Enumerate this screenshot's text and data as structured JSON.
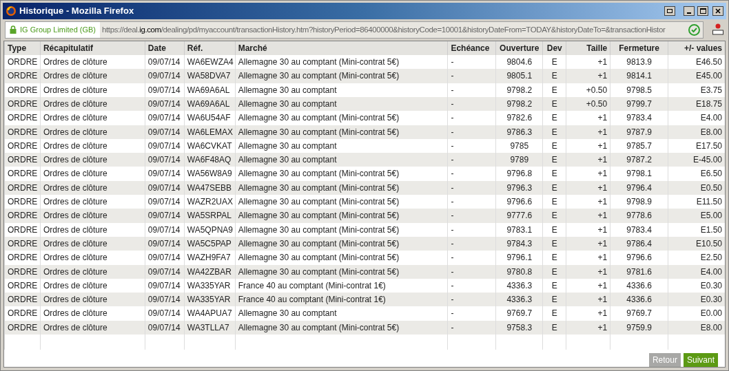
{
  "window": {
    "title": "Historique - Mozilla Firefox"
  },
  "address_bar": {
    "identity": "IG Group Limited (GB)",
    "url_prefix": "https://deal.",
    "url_domain": "ig.com",
    "url_rest": "/dealing/pd/myaccount/transactionHistory.htm?historyPeriod=86400000&historyCode=10001&historyDateFrom=TODAY&historyDateTo=&transactionHistor"
  },
  "table": {
    "columns": [
      "Type",
      "Récapitulatif",
      "Date",
      "Réf.",
      "Marché",
      "Echéance",
      "Ouverture",
      "Dev",
      "Taille",
      "Fermeture",
      "+/- values"
    ],
    "rows": [
      [
        "ORDRE",
        "Ordres de clôture",
        "09/07/14",
        "WA6EWZA4",
        "Allemagne 30 au comptant (Mini-contrat 5€)",
        "-",
        "9804.6",
        "E",
        "+1",
        "9813.9",
        "E46.50"
      ],
      [
        "ORDRE",
        "Ordres de clôture",
        "09/07/14",
        "WA58DVA7",
        "Allemagne 30 au comptant (Mini-contrat 5€)",
        "-",
        "9805.1",
        "E",
        "+1",
        "9814.1",
        "E45.00"
      ],
      [
        "ORDRE",
        "Ordres de clôture",
        "09/07/14",
        "WA69A6AL",
        "Allemagne 30 au comptant",
        "-",
        "9798.2",
        "E",
        "+0.50",
        "9798.5",
        "E3.75"
      ],
      [
        "ORDRE",
        "Ordres de clôture",
        "09/07/14",
        "WA69A6AL",
        "Allemagne 30 au comptant",
        "-",
        "9798.2",
        "E",
        "+0.50",
        "9799.7",
        "E18.75"
      ],
      [
        "ORDRE",
        "Ordres de clôture",
        "09/07/14",
        "WA6U54AF",
        "Allemagne 30 au comptant (Mini-contrat 5€)",
        "-",
        "9782.6",
        "E",
        "+1",
        "9783.4",
        "E4.00"
      ],
      [
        "ORDRE",
        "Ordres de clôture",
        "09/07/14",
        "WA6LEMAX",
        "Allemagne 30 au comptant (Mini-contrat 5€)",
        "-",
        "9786.3",
        "E",
        "+1",
        "9787.9",
        "E8.00"
      ],
      [
        "ORDRE",
        "Ordres de clôture",
        "09/07/14",
        "WA6CVKAT",
        "Allemagne 30 au comptant",
        "-",
        "9785",
        "E",
        "+1",
        "9785.7",
        "E17.50"
      ],
      [
        "ORDRE",
        "Ordres de clôture",
        "09/07/14",
        "WA6F48AQ",
        "Allemagne 30 au comptant",
        "-",
        "9789",
        "E",
        "+1",
        "9787.2",
        "E-45.00"
      ],
      [
        "ORDRE",
        "Ordres de clôture",
        "09/07/14",
        "WA56W8A9",
        "Allemagne 30 au comptant (Mini-contrat 5€)",
        "-",
        "9796.8",
        "E",
        "+1",
        "9798.1",
        "E6.50"
      ],
      [
        "ORDRE",
        "Ordres de clôture",
        "09/07/14",
        "WA47SEBB",
        "Allemagne 30 au comptant (Mini-contrat 5€)",
        "-",
        "9796.3",
        "E",
        "+1",
        "9796.4",
        "E0.50"
      ],
      [
        "ORDRE",
        "Ordres de clôture",
        "09/07/14",
        "WAZR2UAX",
        "Allemagne 30 au comptant (Mini-contrat 5€)",
        "-",
        "9796.6",
        "E",
        "+1",
        "9798.9",
        "E11.50"
      ],
      [
        "ORDRE",
        "Ordres de clôture",
        "09/07/14",
        "WA5SRPAL",
        "Allemagne 30 au comptant (Mini-contrat 5€)",
        "-",
        "9777.6",
        "E",
        "+1",
        "9778.6",
        "E5.00"
      ],
      [
        "ORDRE",
        "Ordres de clôture",
        "09/07/14",
        "WA5QPNA9",
        "Allemagne 30 au comptant (Mini-contrat 5€)",
        "-",
        "9783.1",
        "E",
        "+1",
        "9783.4",
        "E1.50"
      ],
      [
        "ORDRE",
        "Ordres de clôture",
        "09/07/14",
        "WA5C5PAP",
        "Allemagne 30 au comptant (Mini-contrat 5€)",
        "-",
        "9784.3",
        "E",
        "+1",
        "9786.4",
        "E10.50"
      ],
      [
        "ORDRE",
        "Ordres de clôture",
        "09/07/14",
        "WAZH9FA7",
        "Allemagne 30 au comptant (Mini-contrat 5€)",
        "-",
        "9796.1",
        "E",
        "+1",
        "9796.6",
        "E2.50"
      ],
      [
        "ORDRE",
        "Ordres de clôture",
        "09/07/14",
        "WA42ZBAR",
        "Allemagne 30 au comptant (Mini-contrat 5€)",
        "-",
        "9780.8",
        "E",
        "+1",
        "9781.6",
        "E4.00"
      ],
      [
        "ORDRE",
        "Ordres de clôture",
        "09/07/14",
        "WA335YAR",
        "France 40 au comptant (Mini-contrat 1€)",
        "-",
        "4336.3",
        "E",
        "+1",
        "4336.6",
        "E0.30"
      ],
      [
        "ORDRE",
        "Ordres de clôture",
        "09/07/14",
        "WA335YAR",
        "France 40 au comptant (Mini-contrat 1€)",
        "-",
        "4336.3",
        "E",
        "+1",
        "4336.6",
        "E0.30"
      ],
      [
        "ORDRE",
        "Ordres de clôture",
        "09/07/14",
        "WA4APUA7",
        "Allemagne 30 au comptant",
        "-",
        "9769.7",
        "E",
        "+1",
        "9769.7",
        "E0.00"
      ],
      [
        "ORDRE",
        "Ordres de clôture",
        "09/07/14",
        "WA3TLLA7",
        "Allemagne 30 au comptant (Mini-contrat 5€)",
        "-",
        "9758.3",
        "E",
        "+1",
        "9759.9",
        "E8.00"
      ]
    ]
  },
  "buttons": [
    {
      "label": "Retour",
      "disabled": true
    },
    {
      "label": "Suivant",
      "disabled": false
    }
  ]
}
